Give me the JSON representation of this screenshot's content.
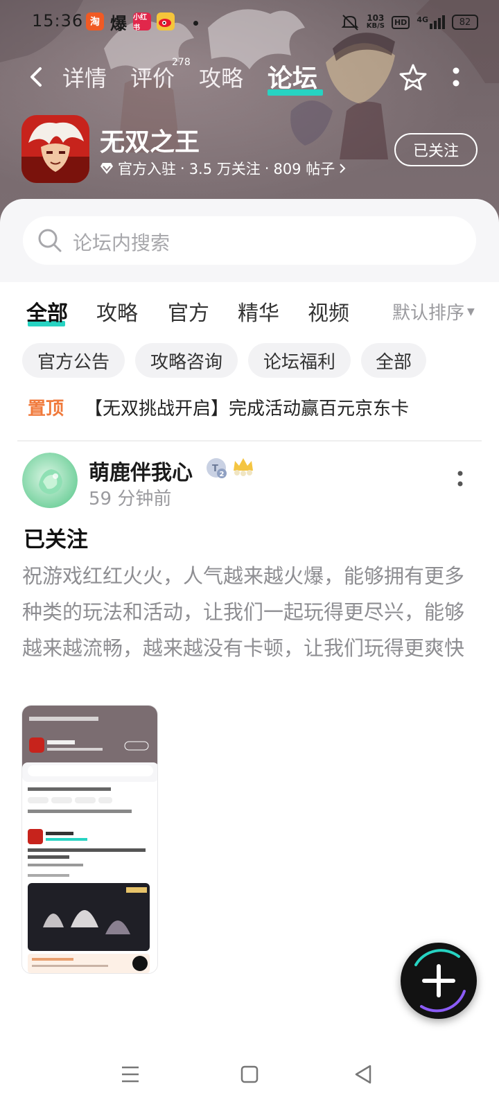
{
  "status_bar": {
    "time": "15:36",
    "net_speed_value": "103",
    "net_speed_unit": "KB/S",
    "hd": "HD",
    "network": "4G",
    "battery": "82",
    "app_icons": [
      "taobao-icon",
      "bao-icon",
      "xiaohongshu-icon",
      "weibo-icon"
    ]
  },
  "nav": {
    "tabs": [
      "详情",
      "评价",
      "攻略",
      "论坛"
    ],
    "active_tab": "论坛",
    "review_count": "278"
  },
  "app": {
    "title": "无双之王",
    "official": "官方入驻",
    "followers": "3.5 万关注",
    "posts": "809 帖子",
    "follow_label": "已关注"
  },
  "search": {
    "placeholder": "论坛内搜索"
  },
  "category_tabs": [
    "全部",
    "攻略",
    "官方",
    "精华",
    "视频"
  ],
  "active_category": "全部",
  "sort_label": "默认排序",
  "chips": [
    "官方公告",
    "攻略咨询",
    "论坛福利",
    "全部"
  ],
  "pinned": {
    "tag": "置顶",
    "text": "【无双挑战开启】完成活动赢百元京东卡"
  },
  "post": {
    "author": "萌鹿伴我心",
    "level": "2",
    "time": "59 分钟前",
    "title": "已关注",
    "body": "祝游戏红红火火，人气越来越火爆，能够拥有更多种类的玩法和活动，让我们一起玩得更尽兴，能够越来越流畅，越来越没有卡顿，让我们玩得更爽快"
  },
  "colors": {
    "accent": "#27d3c2",
    "pinned": "#f07a3c",
    "header_bg": "#7d6f73"
  }
}
